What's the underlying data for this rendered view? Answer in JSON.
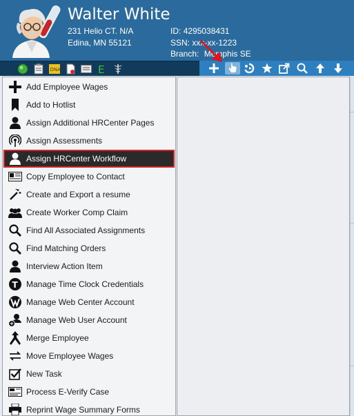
{
  "employee": {
    "name": "Walter White",
    "address_line1": "231 Helio CT. N/A",
    "address_line2": "Edina, MN 55121",
    "id_label": "ID:",
    "id_value": "4295038431",
    "ssn_label": "SSN:",
    "ssn_value": "xxx-xx-1223",
    "branch_label": "Branch:",
    "branch_value": "Memphis SE"
  },
  "toolbar": {
    "left_icons": [
      "status-green-icon",
      "clipboard-icon",
      "dna-icon",
      "document-icon",
      "id-card-icon",
      "e-verify-icon",
      "medical-icon"
    ],
    "right_icons": [
      "plus-icon",
      "pointer-hand-icon",
      "cycle-icon",
      "star-icon",
      "export-icon",
      "search-icon",
      "arrow-up-icon",
      "arrow-down-icon"
    ],
    "active_icon": "pointer-hand-icon"
  },
  "menu": {
    "items": [
      {
        "label": "Add Employee Wages",
        "icon": "plus-icon"
      },
      {
        "label": "Add to Hotlist",
        "icon": "bookmark-icon"
      },
      {
        "label": "Assign Additional HRCenter Pages",
        "icon": "person-icon"
      },
      {
        "label": "Assign Assessments",
        "icon": "broadcast-icon"
      },
      {
        "label": "Assign HRCenter Workflow",
        "icon": "person-icon"
      },
      {
        "label": "Copy Employee to Contact",
        "icon": "contact-card-icon"
      },
      {
        "label": "Create and Export a resume",
        "icon": "magic-wand-icon"
      },
      {
        "label": "Create Worker Comp Claim",
        "icon": "group-icon"
      },
      {
        "label": "Find All Associated Assignments",
        "icon": "search-icon"
      },
      {
        "label": "Find Matching Orders",
        "icon": "search-icon"
      },
      {
        "label": "Interview Action Item",
        "icon": "person-icon"
      },
      {
        "label": "Manage Time Clock Credentials",
        "icon": "clock-badge-icon"
      },
      {
        "label": "Manage Web Center Account",
        "icon": "web-badge-icon"
      },
      {
        "label": "Manage Web User Account",
        "icon": "web-user-icon"
      },
      {
        "label": "Merge Employee",
        "icon": "merge-icon"
      },
      {
        "label": "Move Employee Wages",
        "icon": "move-arrows-icon"
      },
      {
        "label": "New Task",
        "icon": "checkbox-icon"
      },
      {
        "label": "Process E-Verify Case",
        "icon": "e-verify-card-icon"
      },
      {
        "label": "Reprint Wage Summary Forms",
        "icon": "printer-icon"
      }
    ],
    "selected_index": 4
  },
  "colors": {
    "header_bg": "#2b6a9c",
    "toolbar_left_bg": "#123a5a",
    "toolbar_right_bg": "#2d7fbf",
    "selected_bg": "#2a2a2a",
    "selected_border": "#d9252a",
    "annotation_arrow": "#e0141b"
  }
}
